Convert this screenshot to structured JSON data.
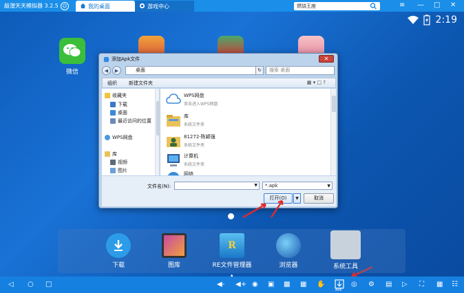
{
  "app": {
    "title": "天天模拟器 3.2.5",
    "title_prefix": "敲潜"
  },
  "tabs": [
    {
      "label": "我的桌面",
      "active": true
    },
    {
      "label": "游戏中心",
      "active": false
    }
  ],
  "search": {
    "value": "燃烧王座"
  },
  "status": {
    "time": "2:19"
  },
  "desktop": {
    "wechat_label": "微信"
  },
  "dialog": {
    "title": "添加Apk文件",
    "address": "桌面",
    "search_placeholder": "搜索 桌面",
    "toolbar": {
      "organize": "组织",
      "new_folder": "新建文件夹"
    },
    "nav_tree": [
      {
        "label": "收藏夹",
        "indent": 0
      },
      {
        "label": "下载",
        "indent": 1
      },
      {
        "label": "桌面",
        "indent": 1
      },
      {
        "label": "最近访问的位置",
        "indent": 1
      },
      {
        "label": "WPS网盘",
        "indent": 0
      },
      {
        "label": "库",
        "indent": 0
      },
      {
        "label": "视频",
        "indent": 1
      },
      {
        "label": "图片",
        "indent": 1
      }
    ],
    "files": [
      {
        "name": "WPS网盘",
        "sub": "双击进入WPS网盘"
      },
      {
        "name": "库",
        "sub": "系统文件夹"
      },
      {
        "name": "81272-陈颖强",
        "sub": "系统文件夹"
      },
      {
        "name": "计算机",
        "sub": "系统文件夹"
      },
      {
        "name": "网络",
        "sub": ""
      }
    ],
    "filename_label": "文件名(N):",
    "filename_value": "",
    "filetype": "*.apk",
    "open_label": "打开(O)",
    "cancel_label": "取消"
  },
  "dock": [
    {
      "label": "下载"
    },
    {
      "label": "图库"
    },
    {
      "label": "RE文件管理器"
    },
    {
      "label": "浏览器"
    },
    {
      "label": "系统工具"
    }
  ],
  "navbar": {
    "apk_label": "APK"
  },
  "colors": {
    "topbar": "#1a8ee8",
    "navbar": "#1580e0",
    "accent_arrow": "#e02a2a"
  }
}
